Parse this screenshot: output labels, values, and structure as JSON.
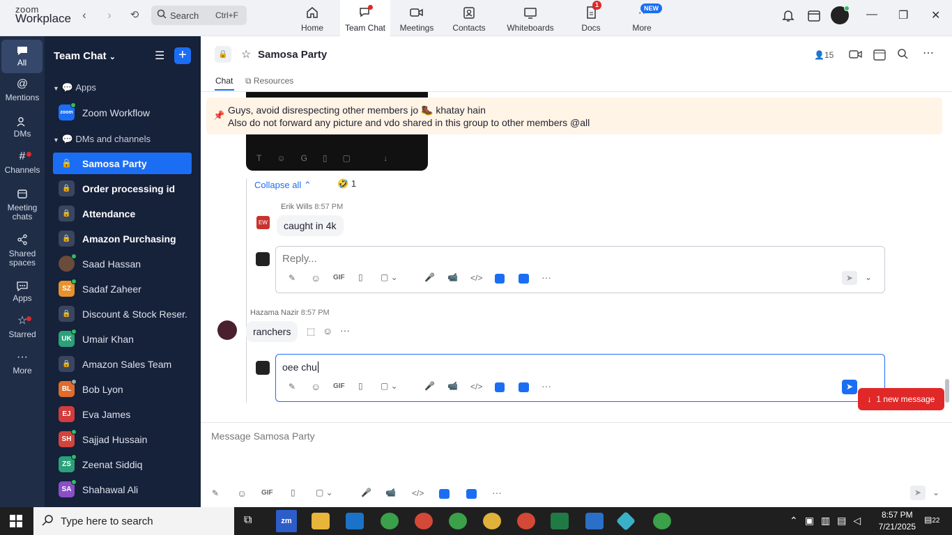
{
  "app": {
    "logo_top": "zoom",
    "logo_bottom": "Workplace"
  },
  "search": {
    "label": "Search",
    "shortcut": "Ctrl+F"
  },
  "tabs": [
    {
      "label": "Home",
      "icon": "home-icon"
    },
    {
      "label": "Team Chat",
      "icon": "chat-icon",
      "active": true
    },
    {
      "label": "Meetings",
      "icon": "video-icon"
    },
    {
      "label": "Contacts",
      "icon": "contacts-icon"
    },
    {
      "label": "Whiteboards",
      "icon": "whiteboard-icon"
    },
    {
      "label": "Docs",
      "icon": "docs-icon",
      "badge": "1"
    },
    {
      "label": "More",
      "icon": "more-icon",
      "badge": "NEW"
    }
  ],
  "rail": [
    {
      "label": "All",
      "icon": "chat-bubble-icon"
    },
    {
      "label": "Mentions",
      "icon": "at-icon"
    },
    {
      "label": "DMs",
      "icon": "people-icon"
    },
    {
      "label": "Channels",
      "icon": "hash-icon"
    },
    {
      "label": "Meeting chats",
      "icon": "calendar-icon"
    },
    {
      "label": "Shared spaces",
      "icon": "share-icon"
    },
    {
      "label": "Apps",
      "icon": "apps-icon"
    },
    {
      "label": "Starred",
      "icon": "star-icon"
    },
    {
      "label": "More",
      "icon": "ellipsis-icon"
    }
  ],
  "sidebar": {
    "title": "Team Chat",
    "apps_section": "Apps",
    "zoom_app": "Zoom Workflow",
    "dm_section": "DMs and channels",
    "items": [
      {
        "name": "Samosa Party",
        "type": "lock",
        "style": "sel"
      },
      {
        "name": "Order processing id",
        "type": "lock",
        "style": "bold"
      },
      {
        "name": "Attendance",
        "type": "lock",
        "style": "bold"
      },
      {
        "name": "Amazon Purchasing",
        "type": "lock",
        "style": "bold"
      },
      {
        "name": "Saad Hassan",
        "type": "photo",
        "color": "#6b4b3a"
      },
      {
        "name": "Sadaf Zaheer",
        "initials": "SZ",
        "color": "#e8922c"
      },
      {
        "name": "Discount & Stock Reser...",
        "type": "lock"
      },
      {
        "name": "Umair Khan",
        "initials": "UK",
        "color": "#2aa17a"
      },
      {
        "name": "Amazon Sales Team",
        "type": "lock"
      },
      {
        "name": "Bob Lyon",
        "initials": "BL",
        "color": "#e06b2a"
      },
      {
        "name": "Eva James",
        "initials": "EJ",
        "color": "#d23c3c"
      },
      {
        "name": "Sajjad Hussain",
        "initials": "SH",
        "color": "#d2443c"
      },
      {
        "name": "Zeenat Siddiq",
        "initials": "ZS",
        "color": "#2aa17a"
      },
      {
        "name": "Shahawal Ali",
        "initials": "SA",
        "color": "#8a4fc8"
      }
    ]
  },
  "channel": {
    "name": "Samosa Party",
    "members": "15",
    "tab_chat": "Chat",
    "tab_resources": "Resources"
  },
  "pinned": {
    "line1": "Guys, avoid disrespecting other members jo 🥾 khatay hain",
    "line2": "Also do not forward any picture and vdo shared in this group to other members @all"
  },
  "thread": {
    "collapse": "Collapse all",
    "reaction": "1",
    "reply_author": "Erik Wills",
    "reply_time": "8:57 PM",
    "reply_initials": "EW",
    "reply_text": "caught in 4k",
    "reply_placeholder": "Reply..."
  },
  "message": {
    "author": "Hazama Nazir",
    "time": "8:57 PM",
    "text": "ranchers",
    "draft": "oee chu"
  },
  "new_message": "1 new message",
  "composer": {
    "placeholder": "Message Samosa Party"
  },
  "taskbar": {
    "search": "Type here to search",
    "time": "8:57 PM",
    "date": "7/21/2025",
    "notif": "22"
  }
}
